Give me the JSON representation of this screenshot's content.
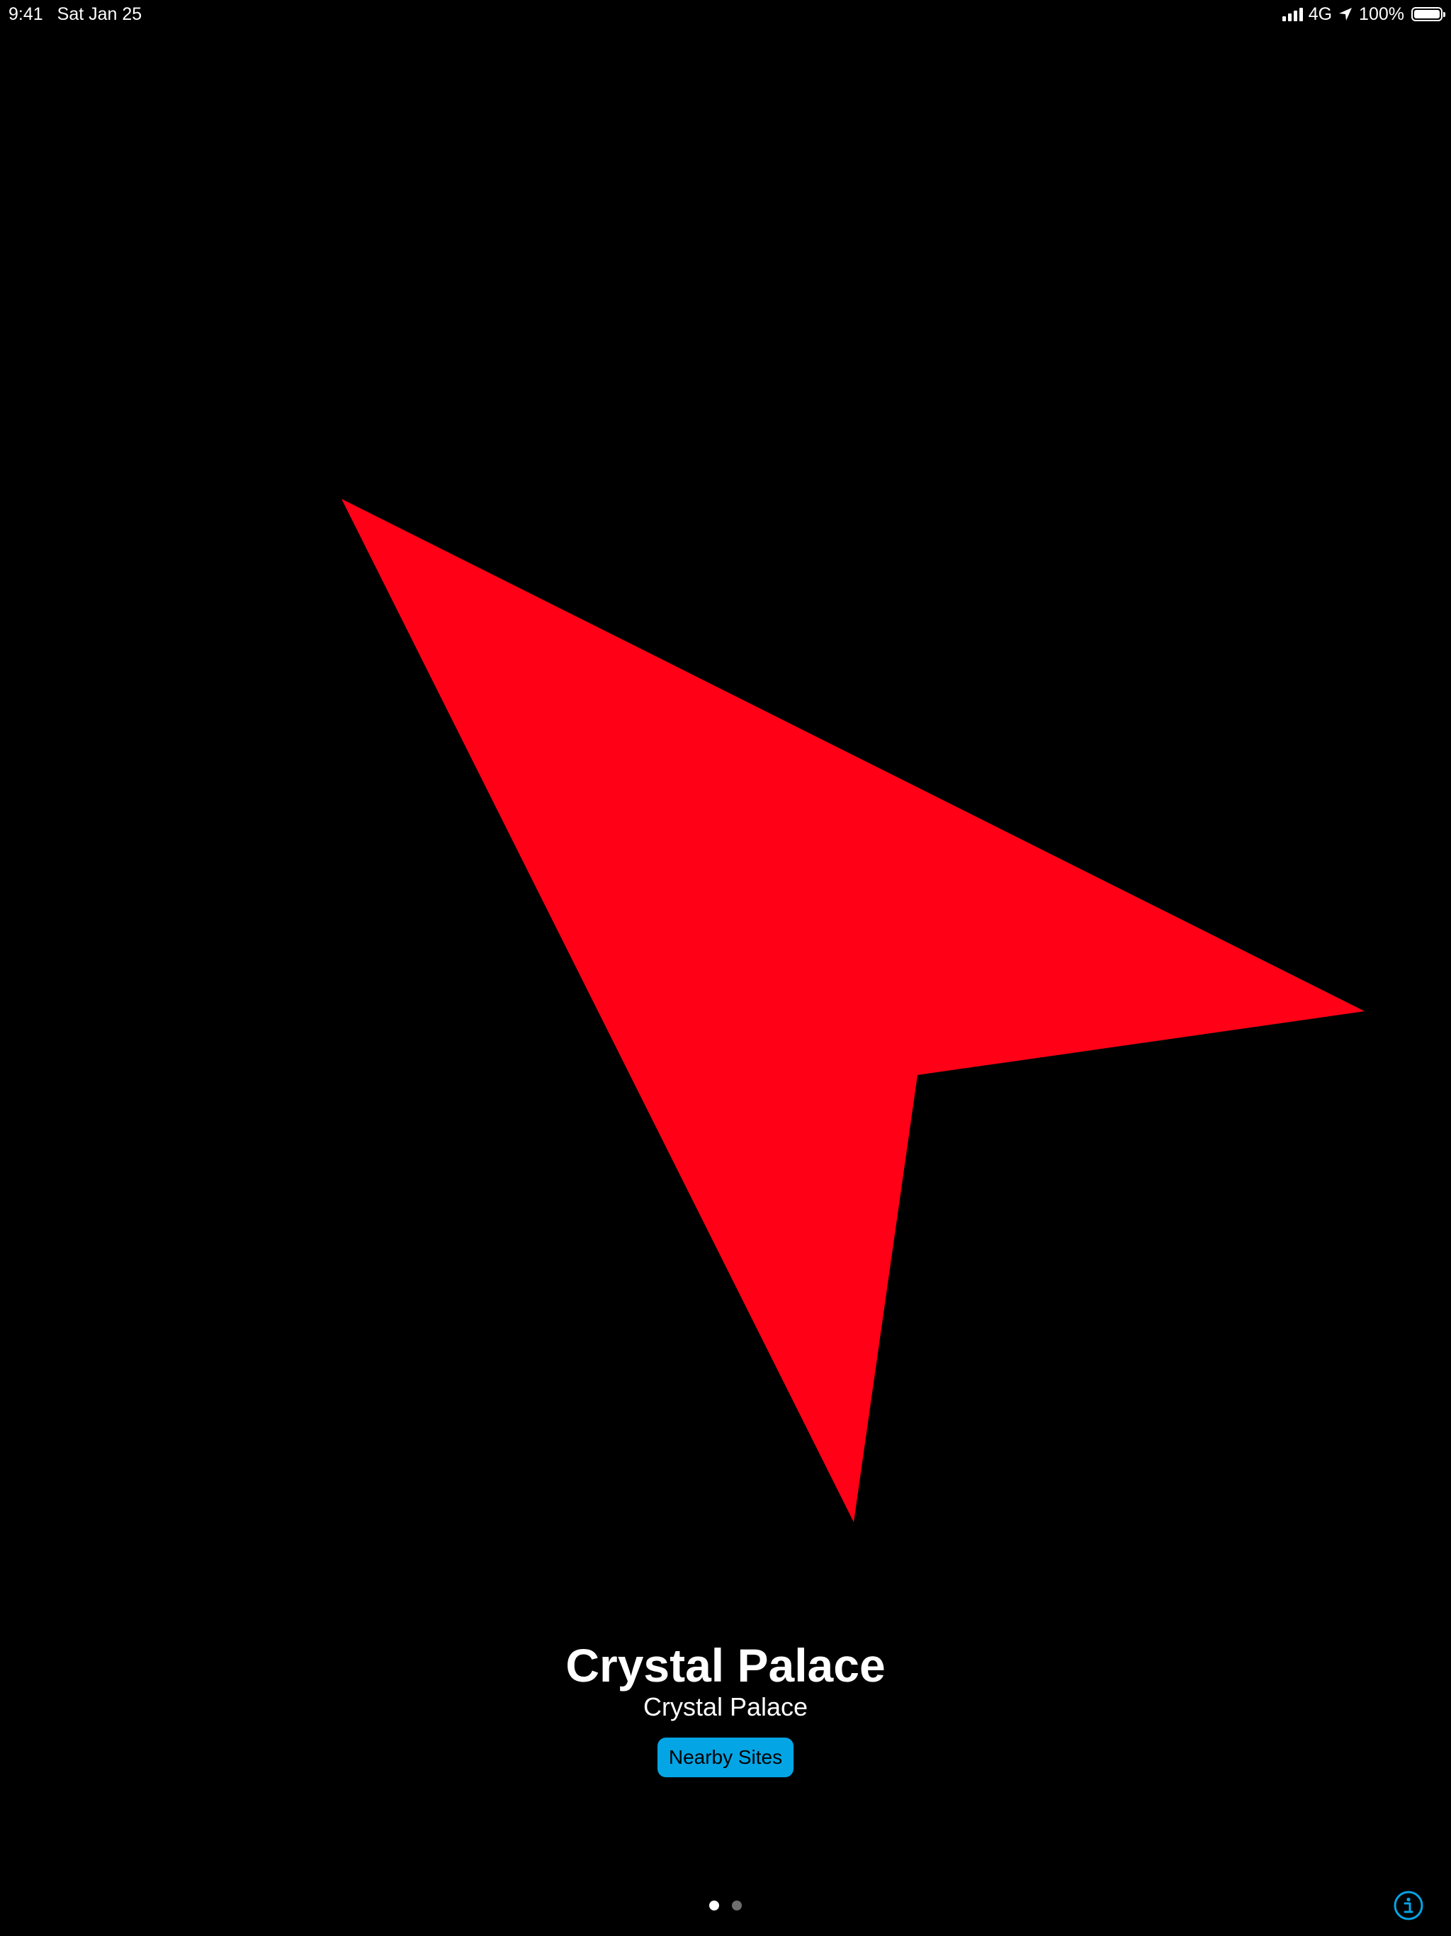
{
  "status_bar": {
    "time": "9:41",
    "date": "Sat Jan 25",
    "network": "4G",
    "battery": "100%",
    "battery_level": 1.0,
    "signal_bars": 4
  },
  "arrow": {
    "color": "#FF0016",
    "icon": "navigation-arrow-icon"
  },
  "place": {
    "title": "Crystal Palace",
    "subtitle": "Crystal Palace"
  },
  "nearby_button": {
    "label": "Nearby Sites",
    "color": "#04A5E5"
  },
  "page_indicator": {
    "total": 2,
    "current": 1
  },
  "info_button": {
    "icon": "info-icon",
    "color": "#04A5E5"
  }
}
